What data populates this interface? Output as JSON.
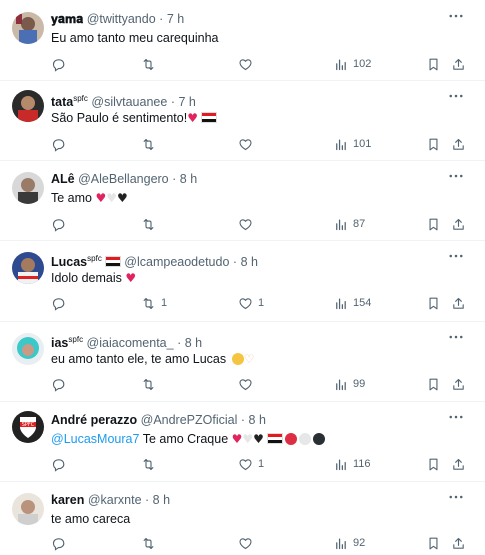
{
  "tweets": [
    {
      "name": "𝐲𝐚𝐦𝐚",
      "handle": "@twittyando",
      "time": "7 h",
      "text": "Eu amo tanto meu carequinha",
      "replies": "",
      "retweets": "",
      "likes": "",
      "views": "102"
    },
    {
      "name": "tata",
      "badge": "spfc",
      "handle": "@silvtauanee",
      "time": "7 h",
      "text": "São Paulo é sentimento!",
      "replies": "",
      "retweets": "",
      "likes": "",
      "views": "101"
    },
    {
      "name": "ALê",
      "handle": "@AleBellangero",
      "time": "8 h",
      "text": "Te amo",
      "replies": "",
      "retweets": "",
      "likes": "",
      "views": "87"
    },
    {
      "name": "Lucas",
      "badge": "spfc",
      "handle": "@lcampeaodetudo",
      "time": "8 h",
      "text": "Idolo demais",
      "replies": "",
      "retweets": "1",
      "likes": "1",
      "views": "154"
    },
    {
      "name": "ias",
      "badge": "spfc",
      "handle": "@iaiacomenta_",
      "time": "8 h",
      "text": "eu amo tanto ele, te amo Lucas",
      "replies": "",
      "retweets": "",
      "likes": "",
      "views": "99"
    },
    {
      "name": "André perazzo",
      "handle": "@AndrePZOficial",
      "time": "8 h",
      "mention": "@LucasMoura7",
      "text": "Te amo Craque",
      "replies": "",
      "retweets": "",
      "likes": "1",
      "views": "116"
    },
    {
      "name": "karen",
      "handle": "@karxnte",
      "time": "8 h",
      "text": "te amo careca",
      "replies": "",
      "retweets": "",
      "likes": "",
      "views": "92"
    }
  ],
  "icons": {
    "reply": "reply-icon",
    "retweet": "retweet-icon",
    "like": "heart-icon",
    "views": "views-icon",
    "bookmark": "bookmark-icon",
    "share": "share-icon",
    "more": "more-icon"
  },
  "colors": {
    "text": "#0f1419",
    "muted": "#536471",
    "link": "#1d9bf0",
    "heart": "#e0245e",
    "divider": "#eff3f4"
  }
}
